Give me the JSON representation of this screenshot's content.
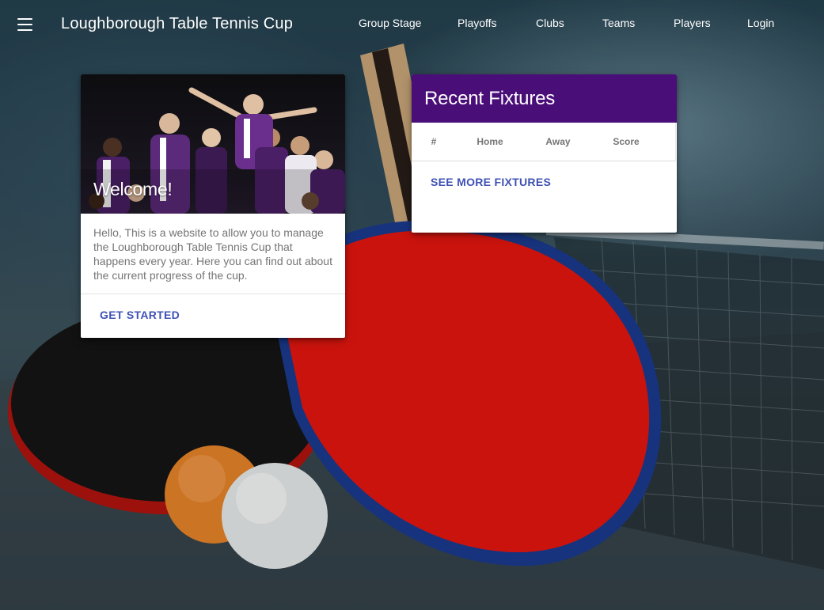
{
  "app": {
    "title": "Loughborough Table Tennis Cup",
    "menu_icon": "menu-icon"
  },
  "nav": {
    "items": [
      {
        "label": "Group Stage"
      },
      {
        "label": "Playoffs"
      },
      {
        "label": "Clubs"
      },
      {
        "label": "Teams"
      },
      {
        "label": "Players"
      },
      {
        "label": "Login"
      }
    ]
  },
  "welcome_card": {
    "title": "Welcome!",
    "text": "Hello, This is a website to allow you to manage the Loughborough Table Tennis Cup that happens every year. Here you can find out about the current progress of the cup.",
    "action_label": "GET STARTED"
  },
  "fixtures_card": {
    "title": "Recent Fixtures",
    "columns": [
      "#",
      "Home",
      "Away",
      "Score"
    ],
    "action_label": "SEE MORE FIXTURES"
  },
  "colors": {
    "header_purple": "#4a0e78",
    "button_blue": "#3f51b5",
    "paddle_red": "#e8160f"
  }
}
